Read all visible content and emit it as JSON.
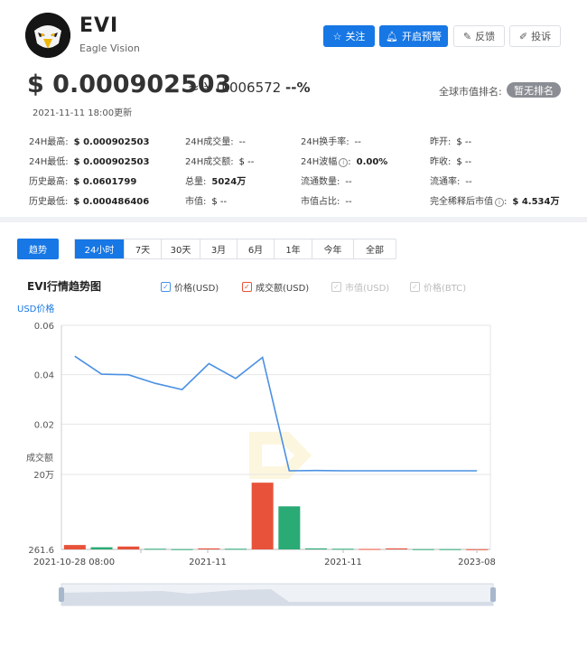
{
  "header": {
    "symbol": "EVI",
    "name": "Eagle Vision",
    "buttons": {
      "follow": "关注",
      "alert": "开启预警",
      "feedback": "反馈",
      "complaint": "投诉"
    }
  },
  "price": {
    "usd": "$ 0.000902503",
    "cny": "≈ ¥ 0.006572",
    "change": "--%",
    "updated": "2021-11-11 18:00更新",
    "rank_label": "全球市值排名:",
    "rank_value": "暂无排名"
  },
  "stats": {
    "high24h": {
      "label": "24H最高:",
      "value": "$ 0.000902503"
    },
    "low24h": {
      "label": "24H最低:",
      "value": "$ 0.000902503"
    },
    "ath": {
      "label": "历史最高:",
      "value": "$ 0.0601799"
    },
    "atl": {
      "label": "历史最低:",
      "value": "$ 0.000486406"
    },
    "vol24h": {
      "label": "24H成交量:",
      "value": "--"
    },
    "amount24h": {
      "label": "24H成交额:",
      "value": "$ --"
    },
    "total_supply": {
      "label": "总量:",
      "value": "5024万"
    },
    "market_cap": {
      "label": "市值:",
      "value": "$ --"
    },
    "turnover24h": {
      "label": "24H换手率:",
      "value": "--"
    },
    "volatility24h": {
      "label": "24H波幅",
      "value": "0.00%"
    },
    "circulating": {
      "label": "流通数量:",
      "value": "--"
    },
    "mcap_share": {
      "label": "市值占比:",
      "value": "--"
    },
    "open": {
      "label": "昨开:",
      "value": "$ --"
    },
    "close": {
      "label": "昨收:",
      "value": "$ --"
    },
    "circ_rate": {
      "label": "流通率:",
      "value": "--"
    },
    "fdv": {
      "label": "完全稀释后市值",
      "value": "$ 4.534万"
    }
  },
  "tabs": {
    "trend": "趋势",
    "ranges": [
      "24小时",
      "7天",
      "30天",
      "3月",
      "6月",
      "1年",
      "今年",
      "全部"
    ],
    "active_range": 0
  },
  "chart_data": {
    "type": "line",
    "title": "EVI行情趋势图",
    "legend": [
      {
        "name": "价格(USD)",
        "checked": true,
        "color": "#4a90e2"
      },
      {
        "name": "成交额(USD)",
        "checked": true,
        "color": "#e8523a"
      },
      {
        "name": "市值(USD)",
        "checked": false,
        "color": "#c7c9cc"
      },
      {
        "name": "价格(BTC)",
        "checked": false,
        "color": "#c7c9cc"
      }
    ],
    "y_price_label": "USD价格",
    "y_price_ticks": [
      "0.06",
      "0.04",
      "0.02"
    ],
    "y_price_range": [
      0,
      0.06
    ],
    "y_volume_label": "成交额",
    "y_volume_ticks": [
      "20万",
      "261.6"
    ],
    "y_volume_range": [
      261.6,
      200000
    ],
    "x_tick_labels": [
      "2021-10-28 08:00",
      "2021-11",
      "2021-11",
      "2023-08"
    ],
    "series": [
      {
        "name": "价格(USD)",
        "color": "#4a90e2",
        "values": [
          0.0475,
          0.0402,
          0.04,
          0.0365,
          0.034,
          0.0445,
          0.0385,
          0.047,
          0.0011,
          0.0012,
          0.0011,
          0.0011,
          0.0011,
          0.0011,
          0.0011,
          0.0011
        ]
      },
      {
        "name": "成交额(USD)",
        "values": [
          12000,
          6000,
          8000,
          2000,
          1000,
          3000,
          2000,
          178000,
          115000,
          3000,
          2000,
          1500,
          3000,
          1000,
          1000,
          800
        ],
        "colors": [
          "#e8523a",
          "#2aaa75",
          "#e8523a",
          "#2aaa75",
          "#2aaa75",
          "#e8523a",
          "#2aaa75",
          "#e8523a",
          "#2aaa75",
          "#2aaa75",
          "#2aaa75",
          "#e8523a",
          "#e8523a",
          "#2aaa75",
          "#2aaa75",
          "#e8523a"
        ]
      }
    ]
  }
}
